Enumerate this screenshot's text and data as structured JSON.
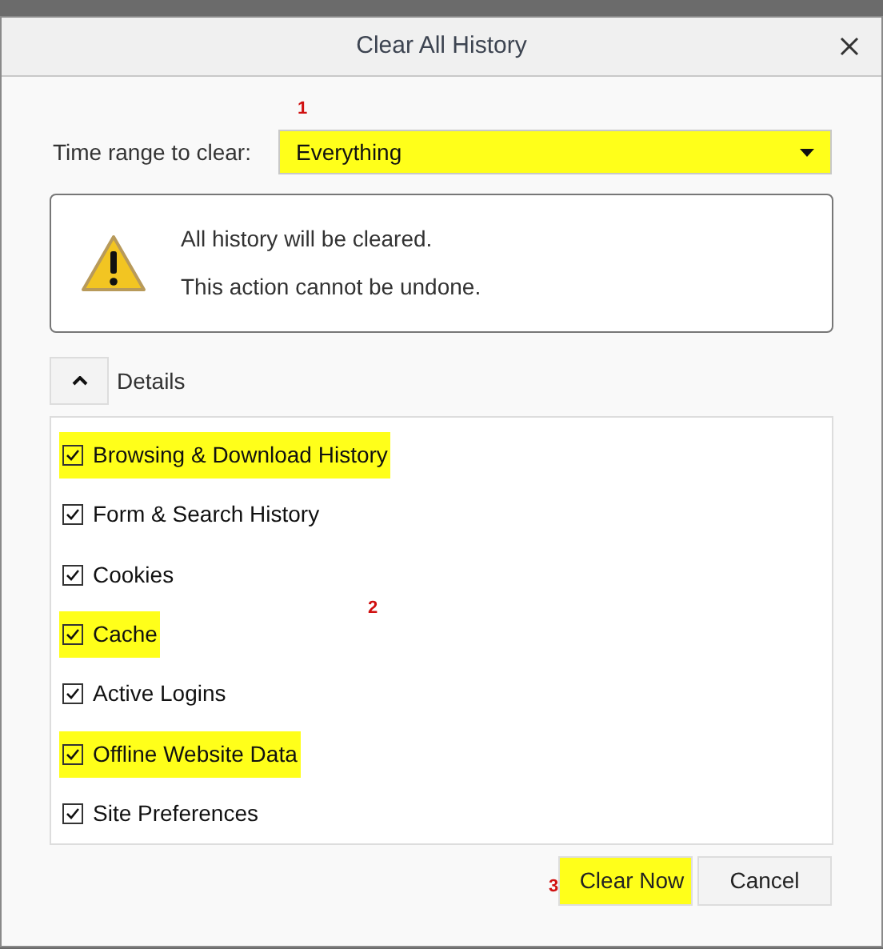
{
  "window": {
    "title": "Clear All History"
  },
  "time_range": {
    "label": "Time range to clear:",
    "value": "Everything",
    "highlighted": true
  },
  "warning": {
    "lines": [
      "All history will be cleared.",
      "This action cannot be undone."
    ]
  },
  "details": {
    "label": "Details",
    "expanded": true
  },
  "items": [
    {
      "label": "Browsing & Download History",
      "checked": true,
      "highlighted": true
    },
    {
      "label": "Form & Search History",
      "checked": true,
      "highlighted": false
    },
    {
      "label": "Cookies",
      "checked": true,
      "highlighted": false
    },
    {
      "label": "Cache",
      "checked": true,
      "highlighted": true
    },
    {
      "label": "Active Logins",
      "checked": true,
      "highlighted": false
    },
    {
      "label": "Offline Website Data",
      "checked": true,
      "highlighted": true
    },
    {
      "label": "Site Preferences",
      "checked": true,
      "highlighted": false
    }
  ],
  "annotations": [
    "1",
    "2",
    "3"
  ],
  "buttons": [
    {
      "label": "Clear Now",
      "highlighted": true
    },
    {
      "label": "Cancel",
      "highlighted": false
    }
  ]
}
